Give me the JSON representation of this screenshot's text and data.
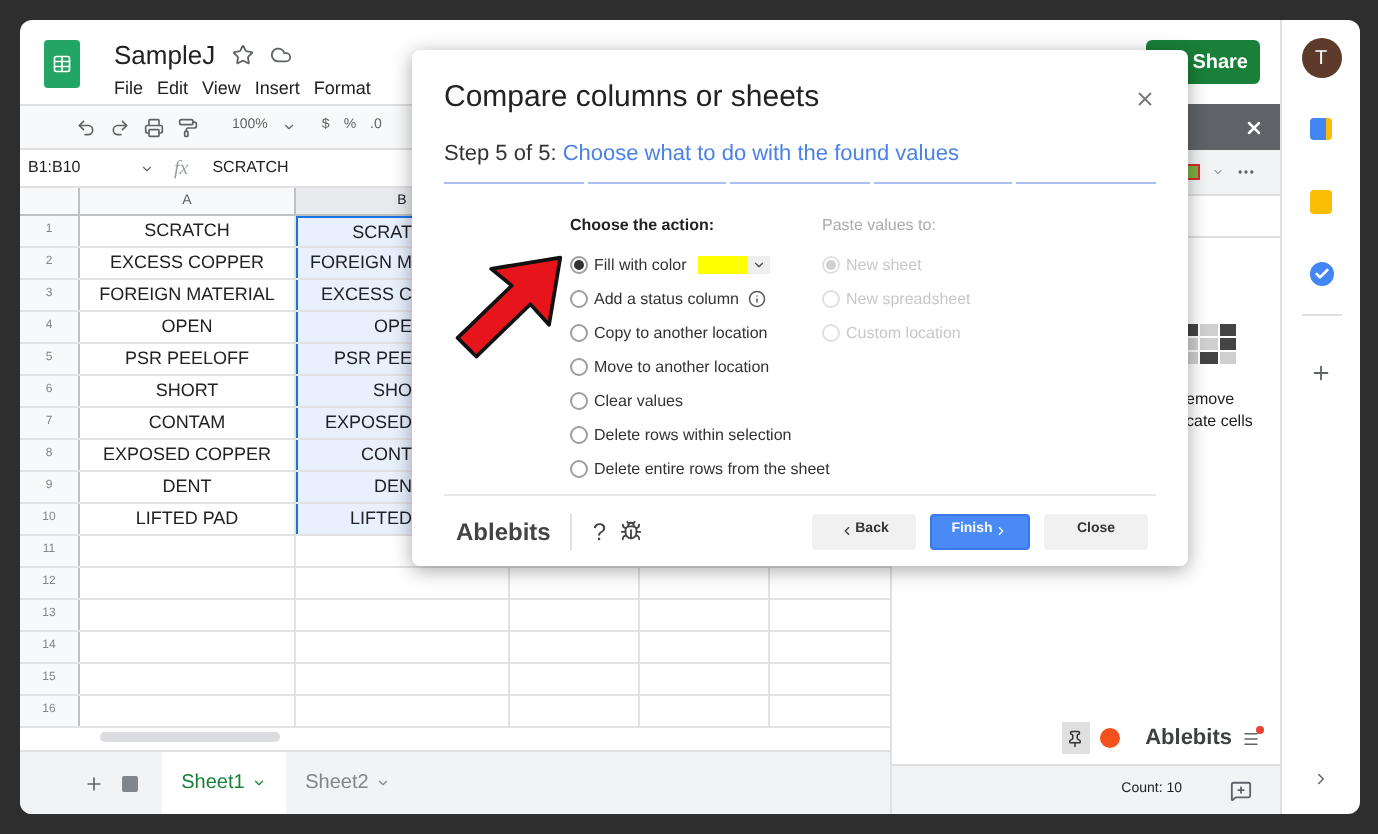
{
  "app": {
    "title": "SampleJ",
    "menu": [
      "File",
      "Edit",
      "View",
      "Insert",
      "Format"
    ],
    "share": "Share",
    "avatar": "T"
  },
  "toolbar": {
    "zoom": "100%",
    "currency": "$",
    "percent": "%",
    "decimal": ".0"
  },
  "formula_bar": {
    "range": "B1:B10",
    "fx": "fx",
    "value": "SCRATCH"
  },
  "grid": {
    "columns": [
      {
        "label": "A",
        "selected": false
      },
      {
        "label": "B",
        "selected": true
      }
    ],
    "rows": [
      {
        "num": "1",
        "cells": [
          "SCRATCH",
          "SCRAT"
        ]
      },
      {
        "num": "2",
        "cells": [
          "EXCESS COPPER",
          "FOREIGN M"
        ]
      },
      {
        "num": "3",
        "cells": [
          "FOREIGN MATERIAL",
          "EXCESS C"
        ]
      },
      {
        "num": "4",
        "cells": [
          "OPEN",
          "OPE"
        ]
      },
      {
        "num": "5",
        "cells": [
          "PSR PEELOFF",
          "PSR PEE"
        ]
      },
      {
        "num": "6",
        "cells": [
          "SHORT",
          "SHO"
        ]
      },
      {
        "num": "7",
        "cells": [
          "CONTAM",
          "EXPOSED"
        ]
      },
      {
        "num": "8",
        "cells": [
          "EXPOSED COPPER",
          "CONT"
        ]
      },
      {
        "num": "9",
        "cells": [
          "DENT",
          "DEN"
        ]
      },
      {
        "num": "10",
        "cells": [
          "LIFTED PAD",
          "LIFTED"
        ]
      },
      {
        "num": "11",
        "cells": []
      },
      {
        "num": "12",
        "cells": []
      },
      {
        "num": "13",
        "cells": []
      },
      {
        "num": "14",
        "cells": []
      },
      {
        "num": "15",
        "cells": []
      },
      {
        "num": "16",
        "cells": []
      }
    ]
  },
  "sheets": [
    {
      "label": "Sheet1",
      "selected": true
    },
    {
      "label": "Sheet2",
      "selected": false
    }
  ],
  "side_panel": {
    "text_lines": [
      "emove",
      "cate cells"
    ],
    "brand": "Ablebits",
    "status": "Count: 10"
  },
  "dialog": {
    "title": "Compare columns or sheets",
    "step": "Step 5 of 5:",
    "step_title": "Choose what to do with the found values",
    "steps": [
      {
        "done": true
      },
      {
        "done": true
      },
      {
        "done": true
      },
      {
        "done": true
      },
      {
        "done": true
      }
    ],
    "actions": {
      "heading": "Choose the action:",
      "options": [
        {
          "label": "Fill with color",
          "selected": true,
          "kind": "color",
          "color": "#ffff00"
        },
        {
          "label": "Add a status column",
          "selected": false,
          "kind": "info"
        },
        {
          "label": "Copy to another location",
          "selected": false,
          "kind": "plain"
        },
        {
          "label": "Move to another location",
          "selected": false,
          "kind": "plain"
        },
        {
          "label": "Clear values",
          "selected": false,
          "kind": "plain"
        },
        {
          "label": "Delete rows within selection",
          "selected": false,
          "kind": "plain"
        },
        {
          "label": "Delete entire rows from the sheet",
          "selected": false,
          "kind": "plain"
        }
      ]
    },
    "paste": {
      "heading": "Paste values to:",
      "disabled": true,
      "options": [
        {
          "label": "New sheet",
          "selected": true
        },
        {
          "label": "New spreadsheet",
          "selected": false
        },
        {
          "label": "Custom location",
          "selected": false
        }
      ]
    },
    "footer": {
      "brand": "Ablebits",
      "help": "?",
      "buttons": [
        {
          "label": "Back",
          "kind": "back"
        },
        {
          "label": "Finish",
          "kind": "primary"
        },
        {
          "label": "Close",
          "kind": "plain"
        }
      ]
    }
  }
}
